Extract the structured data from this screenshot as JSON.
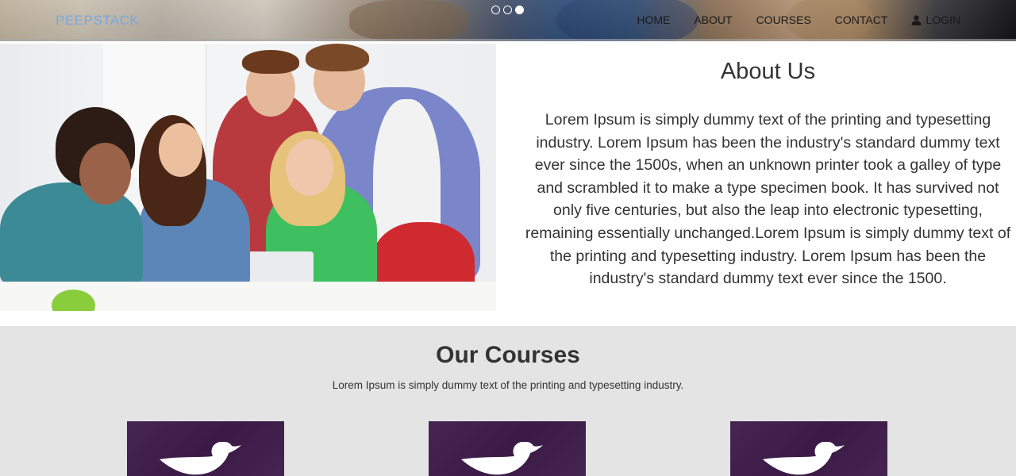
{
  "brand": "PEEPSTACK",
  "nav": {
    "items": [
      "HOME",
      "ABOUT",
      "COURSES",
      "CONTACT"
    ],
    "login_label": "LOGIN"
  },
  "carousel": {
    "slides": 3,
    "active_index": 2
  },
  "about": {
    "title": "About Us",
    "body": "Lorem Ipsum is simply dummy text of the printing and typesetting industry. Lorem Ipsum has been the industry's standard dummy text ever since the 1500s, when an unknown printer took a galley of type and scrambled it to make a type specimen book. It has survived not only five centuries, but also the leap into electronic typesetting, remaining essentially unchanged.Lorem Ipsum is simply dummy text of the printing and typesetting industry. Lorem Ipsum has been the industry's standard dummy text ever since the 1500."
  },
  "courses": {
    "title": "Our Courses",
    "subtitle": "Lorem Ipsum is simply dummy text of the printing and typesetting industry.",
    "cards": [
      {
        "icon": "bird-logo-icon"
      },
      {
        "icon": "bird-logo-icon"
      },
      {
        "icon": "bird-logo-icon"
      }
    ]
  },
  "colors": {
    "brand": "#7aa7e0",
    "course_card": "#3e1c4a",
    "courses_bg": "#e4e4e4"
  }
}
